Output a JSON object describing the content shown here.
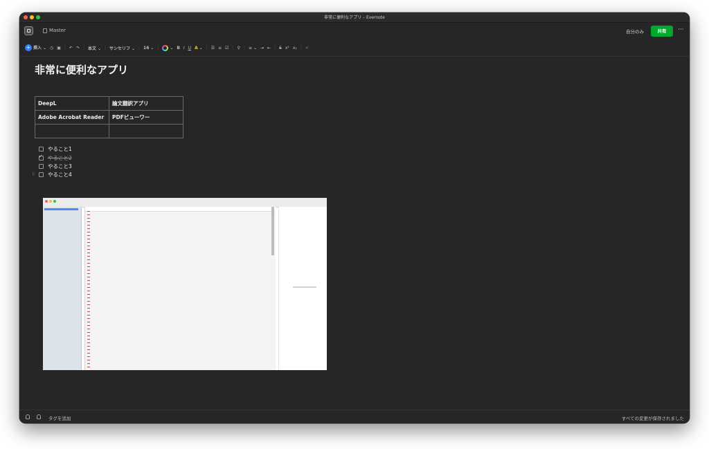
{
  "window": {
    "title": "非常に便利なアプリ – Evernote"
  },
  "topbar": {
    "notebook": "Master",
    "visibility": "自分のみ",
    "share_label": "共有",
    "more_label": "···"
  },
  "toolbar": {
    "insert_label": "挿入",
    "style_label": "本文",
    "font_label": "サンセリフ",
    "size_label": "16",
    "bold": "B",
    "italic": "I",
    "underline": "U",
    "highlight": "A",
    "strike": "S",
    "superscript": "x²",
    "subscript": "x₂",
    "chevron": "⌄"
  },
  "note": {
    "title": "非常に便利なアプリ",
    "table": [
      [
        "DeepL",
        "論文翻訳アプリ"
      ],
      [
        "Adobe Acrobat Reader",
        "PDFビューワー"
      ],
      [
        "",
        ""
      ]
    ],
    "todos": [
      {
        "label": "やること1",
        "checked": false
      },
      {
        "label": "やること2",
        "checked": true
      },
      {
        "label": "やること3",
        "checked": false
      },
      {
        "label": "やること4",
        "checked": false
      }
    ]
  },
  "footer": {
    "add_tag": "タグを追加",
    "save_status": "すべての変更が保存されました"
  },
  "colors": {
    "share": "#00a82d",
    "insert": "#2b7fff",
    "background": "#262626"
  }
}
